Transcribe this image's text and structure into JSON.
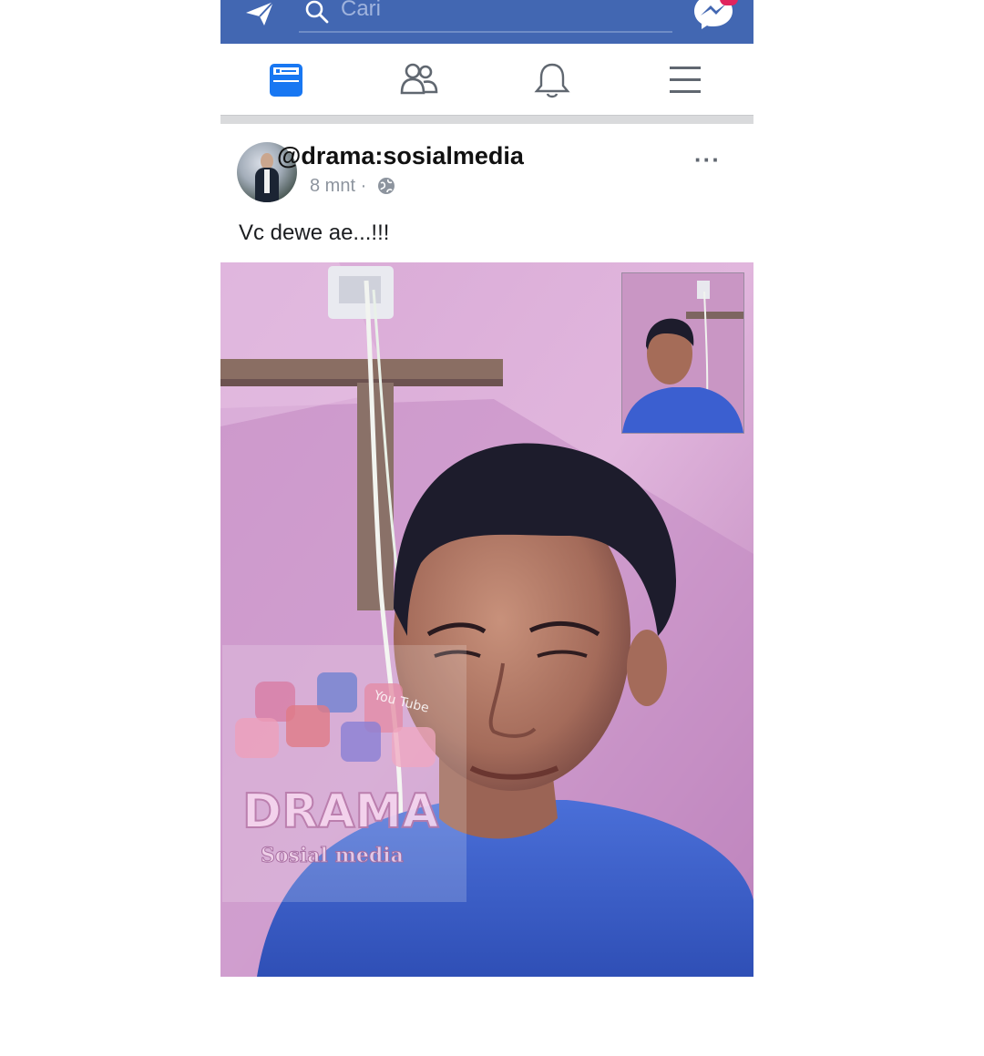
{
  "topbar": {
    "search_placeholder": "Cari",
    "icons": [
      "camera-icon",
      "search-icon",
      "messenger-icon"
    ],
    "colors": {
      "bar": "#4267b2",
      "badge": "#e0245e"
    }
  },
  "nav": {
    "tabs": [
      "news-feed-icon",
      "friends-icon",
      "notifications-icon",
      "menu-icon"
    ],
    "active_color": "#1877f2",
    "inactive_color": "#606770"
  },
  "post": {
    "author": "@drama:sosialmedia",
    "time": "8 mnt",
    "separator": "·",
    "more": "···",
    "caption": "Vc dewe ae...!!!"
  },
  "watermark": {
    "line1": "DRAMA",
    "line2": "Sosial media",
    "badge_text": "You Tube"
  }
}
